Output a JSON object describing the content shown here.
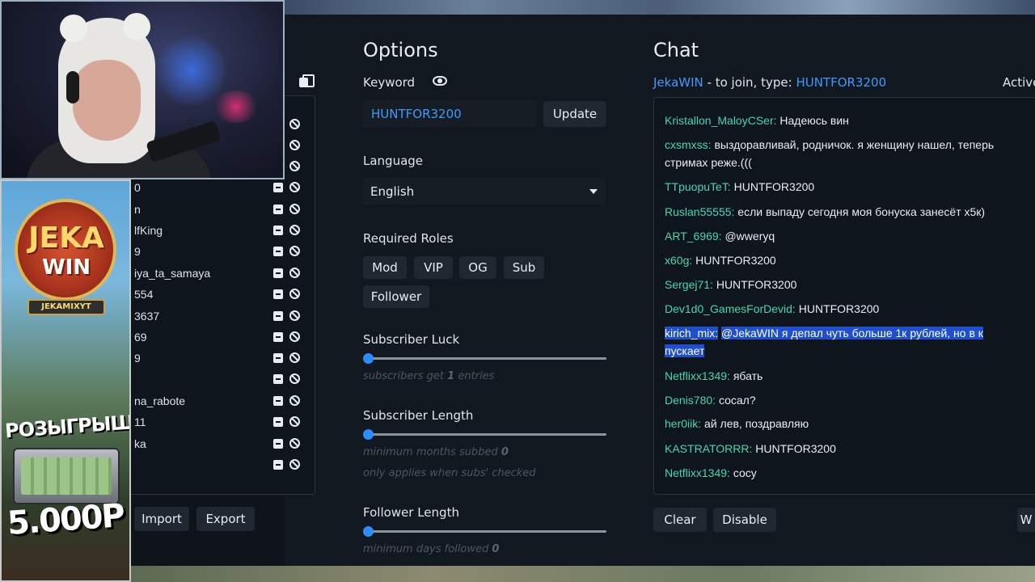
{
  "colors": {
    "accent_blue": "#3d9bff",
    "username_teal": "#45d6b3",
    "panel_bg": "#12181f",
    "highlight": "#1f4fcf"
  },
  "promo": {
    "logo_line1": "JEKA",
    "logo_line2": "WIN",
    "ribbon": "JEKAMIXYT",
    "giveaway": "РОЗЫГРЫШ",
    "prize": "5.000Р"
  },
  "left_panel": {
    "rows": [
      "",
      "",
      "",
      "0",
      "n",
      "lfKing",
      "9",
      "iya_ta_samaya",
      "554",
      "3637",
      "69",
      "9",
      "",
      "na_rabote",
      "11",
      "ka",
      ""
    ],
    "import_label": "Import",
    "export_label": "Export"
  },
  "options": {
    "title": "Options",
    "keyword_label": "Keyword",
    "keyword_value": "HUNTFOR3200",
    "update_label": "Update",
    "language_label": "Language",
    "language_value": "English",
    "roles_label": "Required Roles",
    "roles": [
      "Mod",
      "VIP",
      "OG",
      "Sub",
      "Follower"
    ],
    "sub_luck": {
      "label": "Subscriber Luck",
      "hint_prefix": "subscribers get",
      "value": "1",
      "hint_suffix": "entries"
    },
    "sub_length": {
      "label": "Subscriber Length",
      "hint_prefix": "minimum months subbed",
      "value": "0",
      "hint2": "only applies when subs' checked"
    },
    "follower_length": {
      "label": "Follower Length",
      "hint_prefix": "minimum days followed",
      "value": "0"
    }
  },
  "chat": {
    "title": "Chat",
    "channel": "JekaWIN",
    "join_text": "- to join, type:",
    "keyword": "HUNTFOR3200",
    "status": "Active",
    "messages": [
      {
        "user": "Kristallon_MaloyCSer:",
        "text": "Надеюсь вин"
      },
      {
        "user": "cxsmxss:",
        "text": "выздоравливай, родничок. я женщину нашел, теперь",
        "text2": "стримах реже.((("
      },
      {
        "user": "TTpuopuTeT:",
        "text": "HUNTFOR3200"
      },
      {
        "user": "Ruslan55555:",
        "text": "если выпаду сегодня моя бонуска занесёт х5к)"
      },
      {
        "user": "ART_6969:",
        "text": "@wweryq"
      },
      {
        "user": "x60g:",
        "text": "HUNTFOR3200"
      },
      {
        "user": "Sergej71:",
        "text": "HUNTFOR3200"
      },
      {
        "user": "Dev1d0_GamesForDevid:",
        "text": "HUNTFOR3200"
      },
      {
        "user": "kirich_mix:",
        "text": "@JekaWIN я депал чуть больше 1к рублей, но в к",
        "text2": "пускает"
      },
      {
        "user": "Netflixx1349:",
        "text": "ябать"
      },
      {
        "user": "Denis780:",
        "text": "сосал?"
      },
      {
        "user": "her0iik:",
        "text": "ай лев, поздравляю"
      },
      {
        "user": "KASTRATORRR:",
        "text": "HUNTFOR3200"
      },
      {
        "user": "Netflixx1349:",
        "text": "сосу"
      }
    ],
    "clear_label": "Clear",
    "disable_label": "Disable",
    "right_button_label": "W"
  }
}
